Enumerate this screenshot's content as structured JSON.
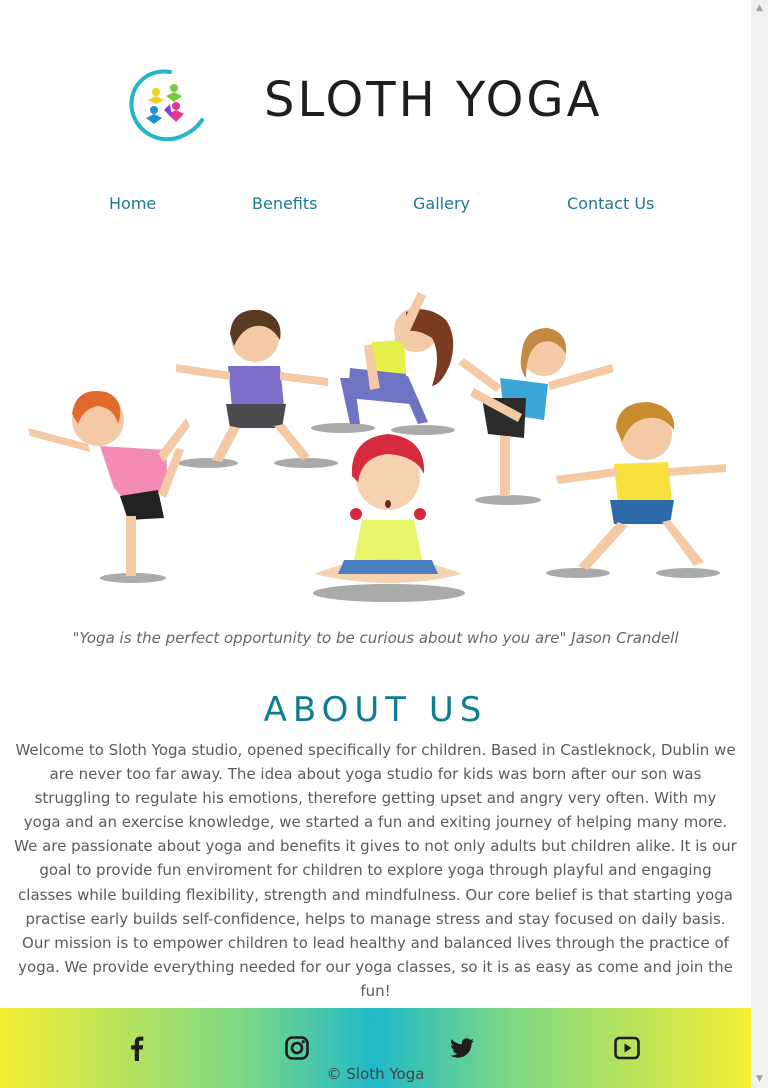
{
  "brand": {
    "name": "SLOTH YOGA"
  },
  "nav": {
    "items": [
      "Home",
      "Benefits",
      "Gallery",
      "Contact Us"
    ]
  },
  "quote": "\"Yoga is the perfect opportunity to be curious about who you are\" Jason Crandell",
  "about": {
    "title": "ABOUT US",
    "text": "Welcome to Sloth Yoga studio, opened specifically for children. Based in Castleknock, Dublin we are never too far away. The idea about yoga studio for kids was born after our son was struggling to regulate his emotions, therefore getting upset and angry very often. With my yoga and an exercise knowledge, we started a fun and exiting journey of helping many more. We are passionate about yoga and benefits it gives to not only adults but children alike. It is our goal to provide fun enviroment for children to explore yoga through playful and engaging classes while building flexibility, strength and mindfulness. Our core belief is that starting yoga practise early builds self-confidence, helps to manage stress and stay focused on daily basis. Our mission is to empower children to lead healthy and balanced lives through the practice of yoga. We provide everything needed for our yoga classes, so it is as easy as come and join the fun!"
  },
  "footer": {
    "social": [
      "facebook-icon",
      "instagram-icon",
      "twitter-icon",
      "youtube-icon"
    ],
    "copyright": "© Sloth Yoga"
  },
  "colors": {
    "accent": "#0d7d92",
    "nav": "#1d7a8c",
    "gradient_edge": "#f3ee33",
    "gradient_center": "#1fb9c9"
  }
}
